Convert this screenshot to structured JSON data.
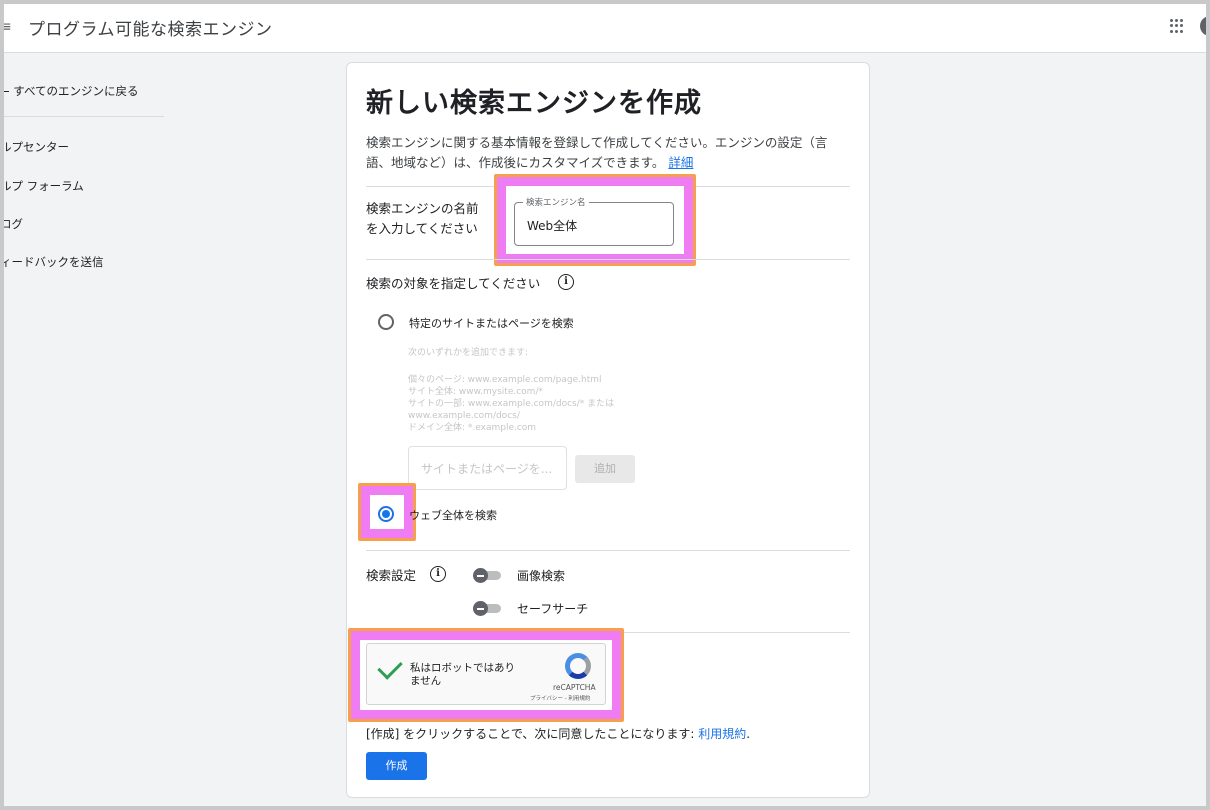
{
  "topbar": {
    "menu_glyph": "≡",
    "title": "プログラム可能な検索エンジン",
    "apps_icon": "apps-grid-icon"
  },
  "sidebar": {
    "back_link": "← すべてのエンジンに戻る",
    "links": [
      "ルプセンター",
      "ルプ フォーラム",
      "ログ",
      "ィードバックを送信"
    ]
  },
  "form": {
    "title": "新しい検索エンジンを作成",
    "description_line1": "検索エンジンに関する基本情報を登録して作成してください。エンジンの設定（言",
    "description_line2": "語、地域など）は、作成後にカスタマイズできます。",
    "details_link": "詳細",
    "name_section_label_1": "検索エンジンの名前",
    "name_section_label_2": "を入力してください",
    "name_field_label": "検索エンジン名",
    "name_field_value": "Web全体",
    "target_label": "検索の対象を指定してください",
    "info_glyph": "i",
    "option_specific_sites": "特定のサイトまたはページを検索",
    "hint_intro": "次のいずれかを追加できます:",
    "hint_lines": [
      "個々のページ: www.example.com/page.html",
      "サイト全体: www.mysite.com/*",
      "サイトの一部: www.example.com/docs/* または",
      "www.example.com/docs/",
      "ドメイン全体: *.example.com"
    ],
    "site_input_placeholder": "サイトまたはページを...",
    "add_button": "追加",
    "option_entire_web": "ウェブ全体を検索",
    "settings_label": "検索設定",
    "toggle_image_search": "画像検索",
    "toggle_safe_search": "セーフサーチ",
    "captcha_text": "私はロボットではありません",
    "recaptcha_name": "reCAPTCHA",
    "recaptcha_links": "プライバシー - 利用規約",
    "terms_prefix": "[作成] をクリックすることで、次に同意したことになります: ",
    "terms_link": "利用規約",
    "terms_suffix": ".",
    "create_button": "作成"
  },
  "colors": {
    "accent": "#1a73e8",
    "highlight": "#f07cf4",
    "highlight_border": "#f6a04d"
  }
}
